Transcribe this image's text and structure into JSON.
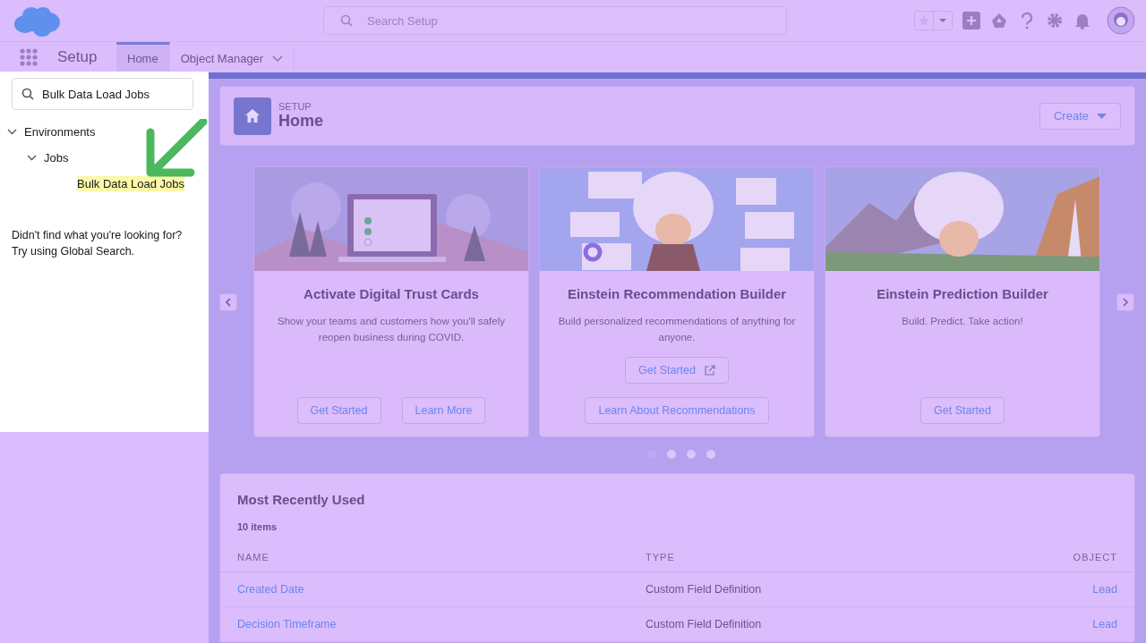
{
  "top_bar": {
    "search": {
      "placeholder": "Search Setup"
    }
  },
  "nav_bar": {
    "app_name": "Setup",
    "tabs": [
      {
        "label": "Home",
        "selected": true,
        "has_menu": false
      },
      {
        "label": "Object Manager",
        "selected": false,
        "has_menu": true
      }
    ]
  },
  "sidebar": {
    "search": {
      "value": "Bulk Data Load Jobs"
    },
    "tree": [
      {
        "label": "Environments",
        "expanded": true,
        "highlighted": false,
        "children": [
          {
            "label": "Jobs",
            "expanded": true,
            "highlighted": false,
            "children": [
              {
                "label": "Bulk Data Load Jobs",
                "highlighted": true
              }
            ]
          }
        ]
      }
    ],
    "message_lines": [
      "Didn't find what you're looking for?",
      "Try using Global Search."
    ]
  },
  "page_header": {
    "eyebrow": "SETUP",
    "title": "Home",
    "create_button": "Create"
  },
  "carousel": {
    "cards": [
      {
        "title": "Activate Digital Trust Cards",
        "description": "Show your teams and customers how you'll safely reopen business during COVID.",
        "kind": "laptop",
        "buttons": [
          {
            "label": "Get Started",
            "external": false
          },
          {
            "label": "Learn More",
            "external": false
          }
        ]
      },
      {
        "title": "Einstein Recommendation Builder",
        "description": "Build personalized recommendations of anything for anyone.",
        "kind": "cards",
        "buttons": [
          {
            "label": "Get Started",
            "external": true
          },
          {
            "label": "Learn About Recommendations",
            "external": false
          }
        ]
      },
      {
        "title": "Einstein Prediction Builder",
        "description": "Build. Predict. Take action!",
        "kind": "mountains",
        "buttons": [
          {
            "label": "Get Started",
            "external": false
          }
        ]
      }
    ],
    "dots": [
      {
        "selected": true
      },
      {
        "selected": false
      },
      {
        "selected": false
      },
      {
        "selected": false
      }
    ]
  },
  "recent": {
    "title": "Most Recently Used",
    "count": "10 items",
    "columns": [
      "NAME",
      "TYPE",
      "OBJECT"
    ],
    "rows": [
      {
        "name": "Created Date",
        "type": "Custom Field Definition",
        "object": "Lead"
      },
      {
        "name": "Decision Timeframe",
        "type": "Custom Field Definition",
        "object": "Lead"
      }
    ]
  }
}
